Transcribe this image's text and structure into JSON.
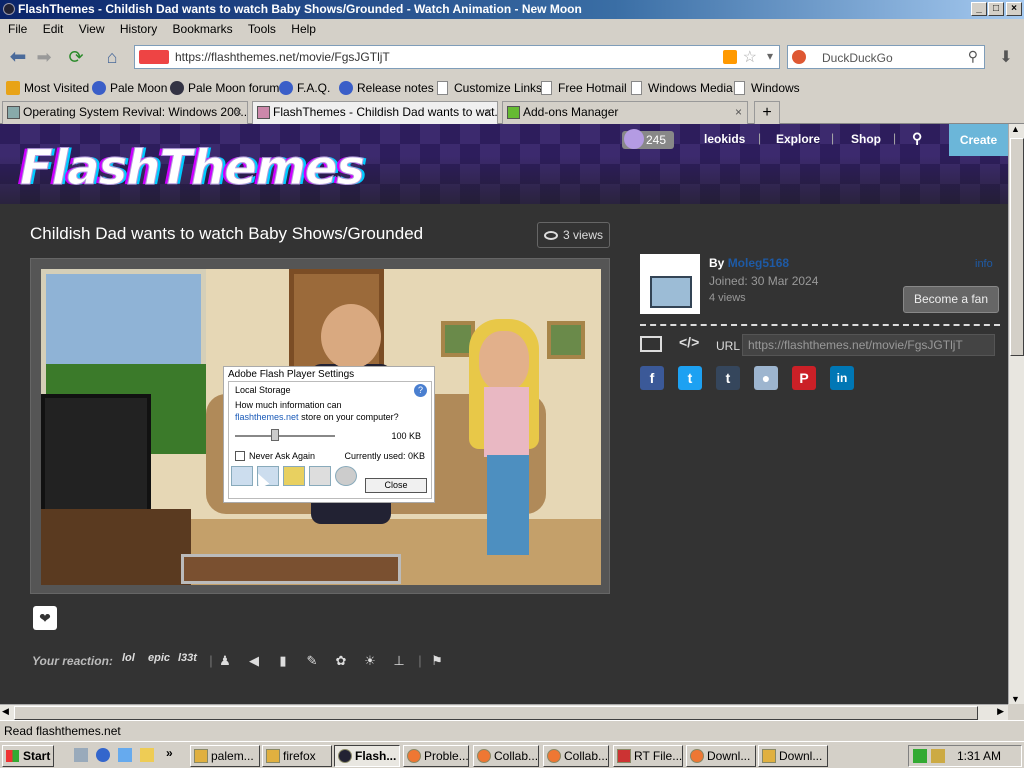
{
  "window": {
    "title": "FlashThemes - Childish Dad wants to watch Baby Shows/Grounded - Watch Animation - New Moon"
  },
  "menu": [
    "File",
    "Edit",
    "View",
    "History",
    "Bookmarks",
    "Tools",
    "Help"
  ],
  "nav": {
    "url": "https://flashthemes.net/movie/FgsJGTljT",
    "search_placeholder": "DuckDuckGo"
  },
  "bookmarks": [
    "Most Visited",
    "Pale Moon",
    "Pale Moon forum",
    "F.A.Q.",
    "Release notes",
    "Customize Links",
    "Free Hotmail",
    "Windows Media",
    "Windows"
  ],
  "tabs": [
    {
      "label": "Operating System Revival: Windows 200..."
    },
    {
      "label": "FlashThemes - Childish Dad wants to wat..."
    },
    {
      "label": "Add-ons Manager"
    }
  ],
  "site": {
    "logo": "FlashThemes",
    "coins": "245",
    "user": "leokids",
    "explore": "Explore",
    "shop": "Shop",
    "create": "Create"
  },
  "video": {
    "title": "Childish Dad wants to watch Baby Shows/Grounded",
    "views": "3 views"
  },
  "flash_dialog": {
    "header": "Adobe Flash Player Settings",
    "section": "Local Storage",
    "question_pre": "How much information can",
    "site": "flashthemes.net",
    "question_post": "store on your computer?",
    "size": "100 KB",
    "never_ask": "Never Ask Again",
    "currently_used": "Currently used: 0KB",
    "close": "Close"
  },
  "reaction": {
    "label": "Your reaction:",
    "lol": "lol",
    "epic": "epic",
    "l33t": "l33t"
  },
  "author": {
    "by_label": "By",
    "name": "Moleg5168",
    "joined": "Joined: 30 Mar 2024",
    "views": "4 views",
    "info": "info",
    "fan_button": "Become a fan"
  },
  "share": {
    "url_label": "URL",
    "url_value": "https://flashthemes.net/movie/FgsJGTljT"
  },
  "status": "Read flashthemes.net",
  "taskbar": {
    "start": "Start",
    "buttons": [
      "palem...",
      "firefox",
      "Flash...",
      "Proble...",
      "Collab...",
      "Collab...",
      "RT File...",
      "Downl...",
      "Downl..."
    ],
    "clock": "1:31 AM"
  }
}
